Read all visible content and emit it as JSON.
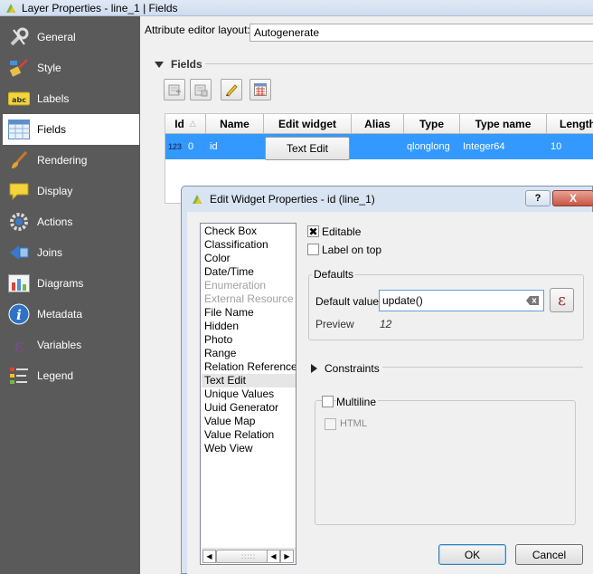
{
  "window": {
    "title": "Layer Properties - line_1 | Fields"
  },
  "sidebar": {
    "items": [
      {
        "label": "General",
        "icon": "wrench-icon"
      },
      {
        "label": "Style",
        "icon": "paintbrush-icon"
      },
      {
        "label": "Labels",
        "icon": "abc-label-icon"
      },
      {
        "label": "Fields",
        "icon": "table-icon",
        "active": true
      },
      {
        "label": "Rendering",
        "icon": "brush-icon"
      },
      {
        "label": "Display",
        "icon": "speech-bubble-icon"
      },
      {
        "label": "Actions",
        "icon": "gear-icon"
      },
      {
        "label": "Joins",
        "icon": "join-icon"
      },
      {
        "label": "Diagrams",
        "icon": "diagram-icon"
      },
      {
        "label": "Metadata",
        "icon": "info-icon"
      },
      {
        "label": "Variables",
        "icon": "epsilon-icon"
      },
      {
        "label": "Legend",
        "icon": "legend-icon"
      }
    ]
  },
  "main": {
    "layout_label": "Attribute editor layout:",
    "layout_value": "Autogenerate",
    "fields_section": "Fields",
    "table": {
      "headers": [
        "Id",
        "Name",
        "Edit widget",
        "Alias",
        "Type",
        "Type name",
        "Length"
      ],
      "row": {
        "type_icon": "123",
        "id": "0",
        "name": "id",
        "edit_widget": "Text Edit",
        "alias": "",
        "type": "qlonglong",
        "type_name": "Integer64",
        "length": "10"
      }
    }
  },
  "dialog": {
    "title": "Edit Widget Properties - id (line_1)",
    "help_label": "?",
    "close_label": "X",
    "widget_list": [
      "Check Box",
      "Classification",
      "Color",
      "Date/Time",
      "Enumeration",
      "External Resource",
      "File Name",
      "Hidden",
      "Photo",
      "Range",
      "Relation Reference",
      "Text Edit",
      "Unique Values",
      "Uuid Generator",
      "Value Map",
      "Value Relation",
      "Web View"
    ],
    "disabled_items": [
      "Enumeration",
      "External Resource"
    ],
    "selected_item": "Text Edit",
    "editable_label": "Editable",
    "label_on_top_label": "Label on top",
    "defaults_title": "Defaults",
    "default_value_label": "Default value",
    "default_value": "update()",
    "expression_label": "ε",
    "preview_label": "Preview",
    "preview_value": "12",
    "constraints_label": "Constraints",
    "multiline_label": "Multiline",
    "html_label": "HTML",
    "ok_label": "OK",
    "cancel_label": "Cancel"
  }
}
